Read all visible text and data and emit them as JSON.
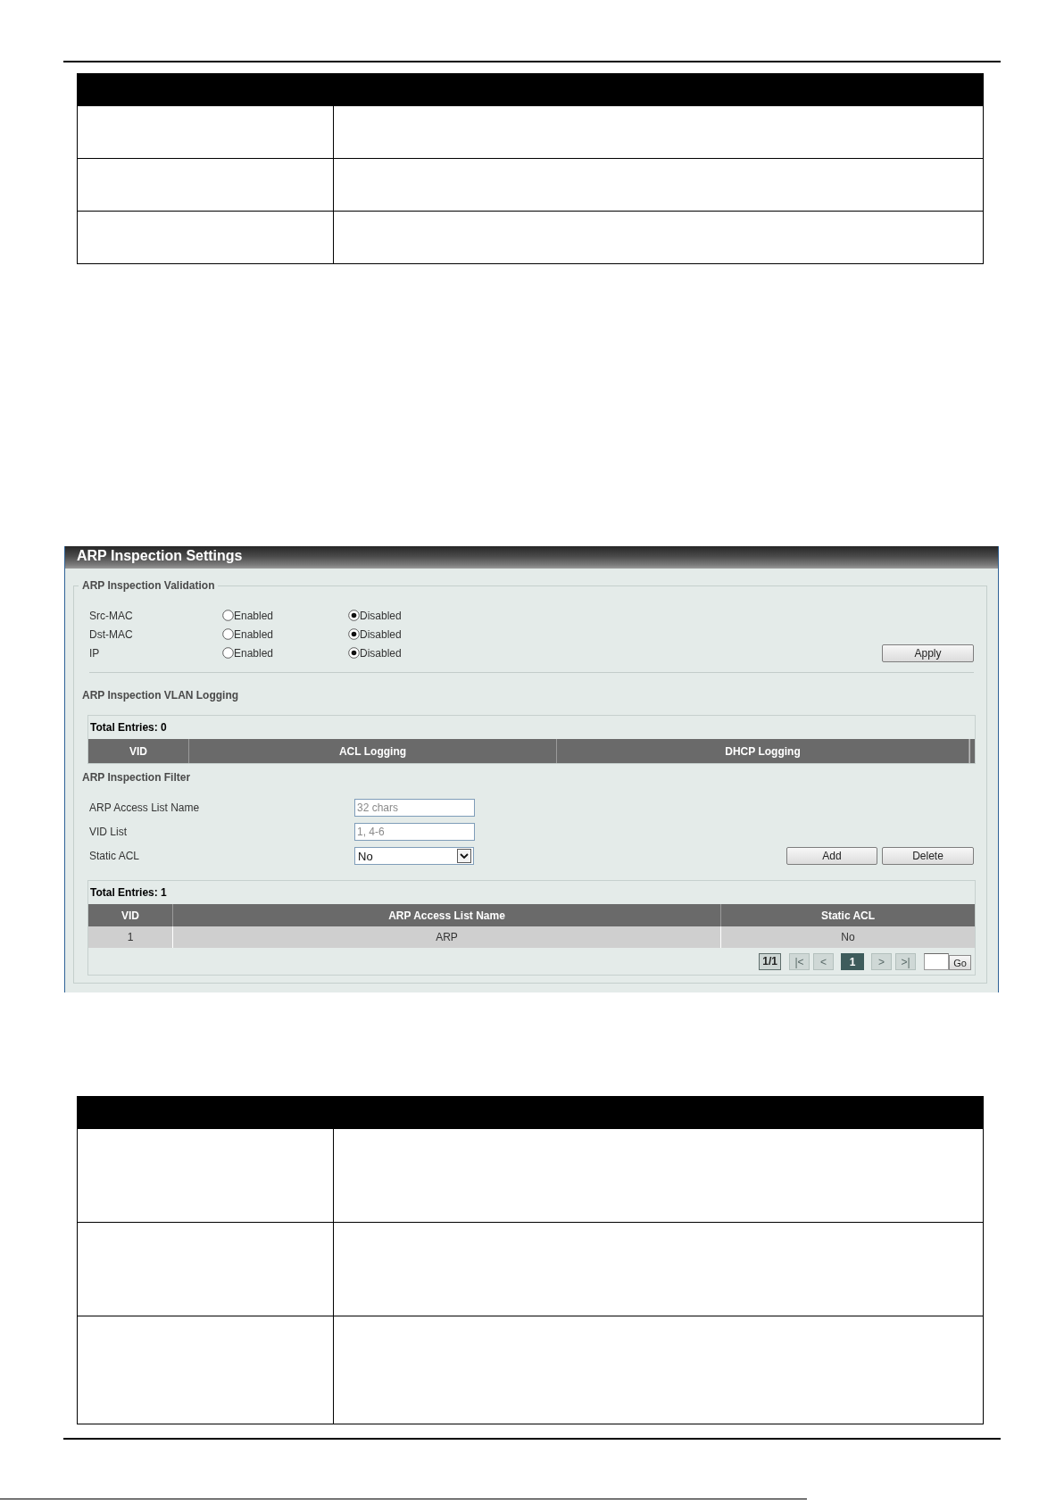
{
  "panel": {
    "title": "ARP Inspection Settings",
    "validation": {
      "legend": "ARP Inspection Validation",
      "rows": [
        {
          "label": "Src-MAC",
          "options": [
            {
              "label": "Enabled",
              "selected": false
            },
            {
              "label": "Disabled",
              "selected": true
            }
          ]
        },
        {
          "label": "Dst-MAC",
          "options": [
            {
              "label": "Enabled",
              "selected": false
            },
            {
              "label": "Disabled",
              "selected": true
            }
          ]
        },
        {
          "label": "IP",
          "options": [
            {
              "label": "Enabled",
              "selected": false
            },
            {
              "label": "Disabled",
              "selected": true
            }
          ]
        }
      ],
      "apply_button": "Apply"
    },
    "vlan_logging": {
      "heading": "ARP Inspection VLAN Logging",
      "total_entries": "Total Entries: 0",
      "columns": [
        "VID",
        "ACL Logging",
        "DHCP Logging"
      ]
    },
    "filter": {
      "heading": "ARP Inspection Filter",
      "fields": [
        {
          "kind": "text",
          "label": "ARP Access List Name",
          "placeholder": "32 chars"
        },
        {
          "kind": "text",
          "label": "VID List",
          "placeholder": "1, 4-6"
        },
        {
          "kind": "select",
          "label": "Static ACL",
          "value": "No"
        }
      ],
      "buttons": [
        "Add",
        "Delete"
      ]
    },
    "filter_table": {
      "total_entries": "Total Entries: 1",
      "columns": [
        "VID",
        "ARP Access List Name",
        "Static ACL"
      ],
      "rows": [
        [
          "1",
          "ARP",
          "No"
        ]
      ]
    },
    "pagination": {
      "indicator": "1/1",
      "controls": [
        {
          "kind": "first",
          "label": "|<",
          "disabled": true,
          "selected": false
        },
        {
          "kind": "prev",
          "label": "<",
          "disabled": true,
          "selected": false
        },
        {
          "kind": "page",
          "label": "1",
          "disabled": false,
          "selected": true
        },
        {
          "kind": "next",
          "label": ">",
          "disabled": true,
          "selected": false
        },
        {
          "kind": "last",
          "label": ">|",
          "disabled": true,
          "selected": false
        }
      ],
      "go_button": "Go"
    }
  }
}
